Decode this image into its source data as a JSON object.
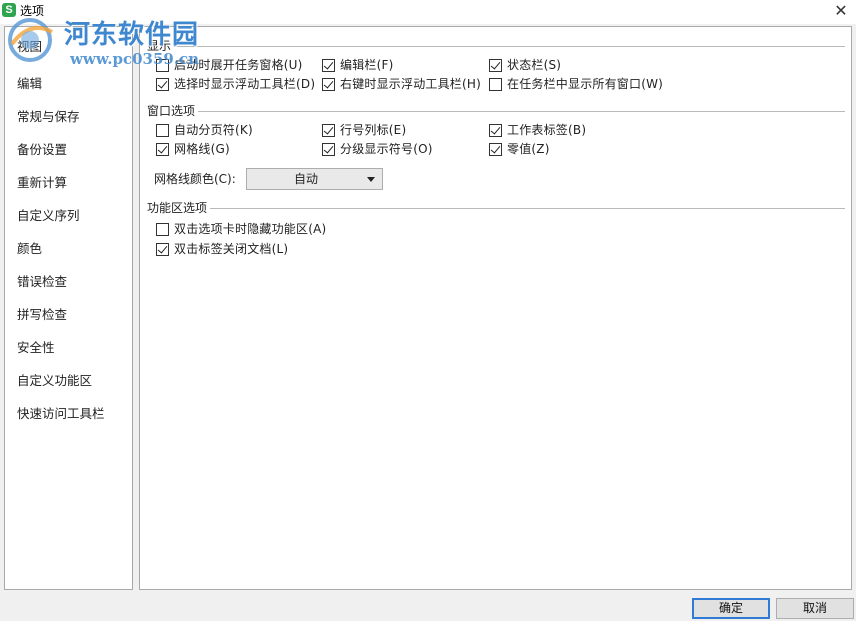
{
  "window": {
    "app_icon_letter": "S",
    "title": "选项",
    "close_symbol": "✕"
  },
  "watermark": {
    "title": "河东软件园",
    "url": "www.pc0359.cn"
  },
  "sidebar": {
    "items": [
      {
        "label": "视图"
      },
      {
        "label": "编辑"
      },
      {
        "label": "常规与保存"
      },
      {
        "label": "备份设置"
      },
      {
        "label": "重新计算"
      },
      {
        "label": "自定义序列"
      },
      {
        "label": "颜色"
      },
      {
        "label": "错误检查"
      },
      {
        "label": "拼写检查"
      },
      {
        "label": "安全性"
      },
      {
        "label": "自定义功能区"
      },
      {
        "label": "快速访问工具栏"
      }
    ]
  },
  "display": {
    "title": "显示",
    "options": [
      {
        "label": "启动时展开任务窗格(U)",
        "checked": false
      },
      {
        "label": "编辑栏(F)",
        "checked": true
      },
      {
        "label": "状态栏(S)",
        "checked": true
      },
      {
        "label": "选择时显示浮动工具栏(D)",
        "checked": true
      },
      {
        "label": "右键时显示浮动工具栏(H)",
        "checked": true
      },
      {
        "label": "在任务栏中显示所有窗口(W)",
        "checked": false
      }
    ]
  },
  "window_options": {
    "title": "窗口选项",
    "options": [
      {
        "label": "自动分页符(K)",
        "checked": false
      },
      {
        "label": "行号列标(E)",
        "checked": true
      },
      {
        "label": "工作表标签(B)",
        "checked": true
      },
      {
        "label": "网格线(G)",
        "checked": true
      },
      {
        "label": "分级显示符号(O)",
        "checked": true
      },
      {
        "label": "零值(Z)",
        "checked": true
      }
    ],
    "gridline_color_label": "网格线颜色(C):",
    "gridline_color_value": "自动"
  },
  "ribbon_options": {
    "title": "功能区选项",
    "options": [
      {
        "label": "双击选项卡时隐藏功能区(A)",
        "checked": false
      },
      {
        "label": "双击标签关闭文档(L)",
        "checked": true
      }
    ]
  },
  "buttons": {
    "ok": "确定",
    "cancel": "取消"
  }
}
